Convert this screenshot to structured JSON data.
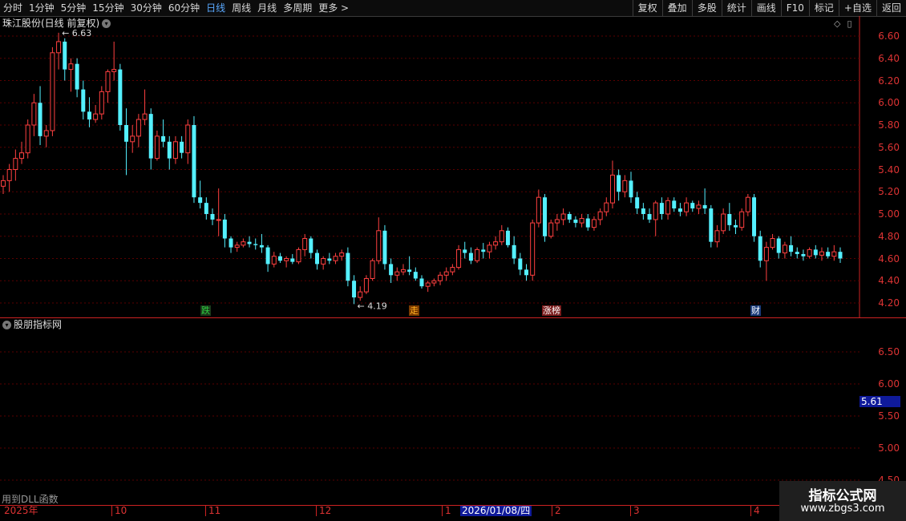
{
  "toolbar": {
    "periods": [
      "分时",
      "1分钟",
      "5分钟",
      "15分钟",
      "30分钟",
      "60分钟",
      "日线",
      "周线",
      "月线",
      "多周期",
      "更多 >"
    ],
    "active_period": "日线",
    "buttons": [
      "复权",
      "叠加",
      "多股",
      "统计",
      "画线",
      "F10",
      "标记",
      "+自选",
      "返回"
    ]
  },
  "title": {
    "label": "珠江股份(日线 前复权)"
  },
  "main_axis": [
    "6.60",
    "6.40",
    "6.20",
    "6.00",
    "5.80",
    "5.60",
    "5.40",
    "5.20",
    "5.00",
    "4.80",
    "4.60",
    "4.40",
    "4.20"
  ],
  "max_label": "6.63",
  "min_label": "4.19",
  "tags": [
    {
      "text": "跌",
      "color": "#2ecc40",
      "bg": "#1a3a1a"
    },
    {
      "text": "走",
      "color": "#ffb020",
      "bg": "#7a3a00"
    },
    {
      "text": "涨榜",
      "color": "#ffffff",
      "bg": "#7a1a1a"
    },
    {
      "text": "财",
      "color": "#ffffff",
      "bg": "#1a3a7a"
    }
  ],
  "indicator": {
    "title": "股朋指标网",
    "axis": [
      "6.50",
      "6.00",
      "5.50",
      "5.00",
      "4.50"
    ],
    "current_value": "5.61",
    "dll_text": "用到DLL函数"
  },
  "dates": {
    "labels": [
      "2025年",
      "10",
      "11",
      "12",
      "1",
      "2",
      "3",
      "4"
    ],
    "current": "2026/01/08/四"
  },
  "watermark": {
    "line1": "指标公式网",
    "line2": "www.zbgs3.com"
  },
  "colors": {
    "up": "#ff4040",
    "down": "#54f0ff",
    "grid": "#5a0000",
    "axis": "#cc2222"
  },
  "chart_data": {
    "type": "candlestick",
    "title": "珠江股份(日线 前复权)",
    "ylim": [
      4.12,
      6.68
    ],
    "max": 6.63,
    "min": 4.19,
    "candles": [
      [
        5.25,
        5.35,
        5.18,
        5.3
      ],
      [
        5.3,
        5.45,
        5.2,
        5.4
      ],
      [
        5.4,
        5.58,
        5.3,
        5.5
      ],
      [
        5.5,
        5.65,
        5.45,
        5.55
      ],
      [
        5.55,
        5.85,
        5.5,
        5.8
      ],
      [
        5.8,
        6.08,
        5.7,
        6.0
      ],
      [
        6.0,
        6.15,
        5.62,
        5.7
      ],
      [
        5.7,
        5.8,
        5.6,
        5.75
      ],
      [
        5.75,
        6.5,
        5.7,
        6.45
      ],
      [
        6.45,
        6.63,
        6.3,
        6.55
      ],
      [
        6.55,
        6.58,
        6.2,
        6.3
      ],
      [
        6.3,
        6.4,
        6.1,
        6.35
      ],
      [
        6.35,
        6.4,
        6.05,
        6.12
      ],
      [
        6.12,
        6.2,
        5.85,
        5.92
      ],
      [
        5.92,
        6.05,
        5.78,
        5.85
      ],
      [
        5.85,
        5.98,
        5.82,
        5.9
      ],
      [
        5.9,
        6.15,
        5.85,
        6.1
      ],
      [
        6.1,
        6.3,
        6.0,
        6.28
      ],
      [
        6.28,
        6.55,
        6.2,
        6.3
      ],
      [
        6.3,
        6.35,
        5.75,
        5.8
      ],
      [
        5.8,
        5.95,
        5.35,
        5.65
      ],
      [
        5.65,
        5.8,
        5.55,
        5.7
      ],
      [
        5.7,
        5.9,
        5.6,
        5.85
      ],
      [
        5.85,
        6.12,
        5.8,
        5.9
      ],
      [
        5.9,
        5.95,
        5.4,
        5.5
      ],
      [
        5.5,
        5.75,
        5.48,
        5.7
      ],
      [
        5.7,
        5.85,
        5.6,
        5.65
      ],
      [
        5.65,
        5.7,
        5.4,
        5.5
      ],
      [
        5.5,
        5.7,
        5.45,
        5.65
      ],
      [
        5.65,
        5.7,
        5.5,
        5.55
      ],
      [
        5.55,
        5.85,
        5.45,
        5.8
      ],
      [
        5.8,
        5.88,
        5.1,
        5.15
      ],
      [
        5.15,
        5.3,
        5.05,
        5.1
      ],
      [
        5.1,
        5.15,
        4.95,
        5.0
      ],
      [
        5.0,
        5.05,
        4.9,
        4.95
      ],
      [
        4.95,
        5.23,
        4.8,
        4.95
      ],
      [
        4.95,
        5.0,
        4.7,
        4.78
      ],
      [
        4.78,
        4.8,
        4.65,
        4.7
      ],
      [
        4.7,
        4.75,
        4.66,
        4.72
      ],
      [
        4.72,
        4.78,
        4.7,
        4.75
      ],
      [
        4.75,
        4.8,
        4.7,
        4.73
      ],
      [
        4.73,
        4.78,
        4.68,
        4.72
      ],
      [
        4.72,
        4.82,
        4.65,
        4.7
      ],
      [
        4.7,
        4.72,
        4.48,
        4.55
      ],
      [
        4.55,
        4.66,
        4.52,
        4.62
      ],
      [
        4.62,
        4.65,
        4.56,
        4.58
      ],
      [
        4.58,
        4.62,
        4.52,
        4.6
      ],
      [
        4.6,
        4.64,
        4.55,
        4.57
      ],
      [
        4.57,
        4.7,
        4.55,
        4.68
      ],
      [
        4.68,
        4.82,
        4.62,
        4.78
      ],
      [
        4.78,
        4.8,
        4.6,
        4.65
      ],
      [
        4.65,
        4.68,
        4.5,
        4.55
      ],
      [
        4.55,
        4.62,
        4.5,
        4.6
      ],
      [
        4.6,
        4.65,
        4.55,
        4.58
      ],
      [
        4.58,
        4.65,
        4.55,
        4.62
      ],
      [
        4.62,
        4.68,
        4.58,
        4.65
      ],
      [
        4.65,
        4.7,
        4.35,
        4.4
      ],
      [
        4.4,
        4.45,
        4.19,
        4.25
      ],
      [
        4.25,
        4.35,
        4.22,
        4.3
      ],
      [
        4.3,
        4.45,
        4.28,
        4.42
      ],
      [
        4.42,
        4.6,
        4.4,
        4.58
      ],
      [
        4.58,
        4.97,
        4.55,
        4.85
      ],
      [
        4.85,
        4.9,
        4.5,
        4.55
      ],
      [
        4.55,
        4.6,
        4.38,
        4.45
      ],
      [
        4.45,
        4.52,
        4.4,
        4.48
      ],
      [
        4.48,
        4.55,
        4.45,
        4.5
      ],
      [
        4.5,
        4.62,
        4.45,
        4.48
      ],
      [
        4.48,
        4.52,
        4.4,
        4.42
      ],
      [
        4.42,
        4.45,
        4.33,
        4.35
      ],
      [
        4.35,
        4.4,
        4.3,
        4.38
      ],
      [
        4.38,
        4.42,
        4.35,
        4.4
      ],
      [
        4.4,
        4.48,
        4.36,
        4.45
      ],
      [
        4.45,
        4.52,
        4.4,
        4.48
      ],
      [
        4.48,
        4.55,
        4.45,
        4.52
      ],
      [
        4.52,
        4.72,
        4.5,
        4.68
      ],
      [
        4.68,
        4.75,
        4.6,
        4.65
      ],
      [
        4.65,
        4.7,
        4.55,
        4.58
      ],
      [
        4.58,
        4.7,
        4.56,
        4.68
      ],
      [
        4.68,
        4.74,
        4.6,
        4.66
      ],
      [
        4.66,
        4.75,
        4.6,
        4.72
      ],
      [
        4.72,
        4.8,
        4.68,
        4.75
      ],
      [
        4.75,
        4.9,
        4.72,
        4.85
      ],
      [
        4.85,
        4.88,
        4.7,
        4.72
      ],
      [
        4.72,
        4.8,
        4.55,
        4.6
      ],
      [
        4.6,
        4.65,
        4.45,
        4.5
      ],
      [
        4.5,
        4.55,
        4.4,
        4.45
      ],
      [
        4.45,
        4.95,
        4.4,
        4.92
      ],
      [
        4.92,
        5.22,
        4.88,
        5.15
      ],
      [
        5.15,
        5.18,
        4.75,
        4.8
      ],
      [
        4.8,
        4.95,
        4.78,
        4.92
      ],
      [
        4.92,
        5.0,
        4.85,
        4.95
      ],
      [
        4.95,
        5.05,
        4.9,
        5.0
      ],
      [
        5.0,
        5.02,
        4.92,
        4.95
      ],
      [
        4.95,
        4.98,
        4.88,
        4.92
      ],
      [
        4.92,
        5.0,
        4.88,
        4.96
      ],
      [
        4.96,
        5.0,
        4.85,
        4.88
      ],
      [
        4.88,
        4.98,
        4.85,
        4.95
      ],
      [
        4.95,
        5.05,
        4.9,
        5.02
      ],
      [
        5.02,
        5.15,
        4.98,
        5.1
      ],
      [
        5.1,
        5.48,
        5.05,
        5.35
      ],
      [
        5.35,
        5.4,
        5.12,
        5.2
      ],
      [
        5.2,
        5.35,
        5.15,
        5.3
      ],
      [
        5.3,
        5.38,
        5.1,
        5.15
      ],
      [
        5.15,
        5.2,
        5.0,
        5.05
      ],
      [
        5.05,
        5.1,
        4.95,
        5.0
      ],
      [
        5.0,
        5.05,
        4.92,
        4.95
      ],
      [
        4.95,
        5.12,
        4.8,
        5.1
      ],
      [
        5.1,
        5.15,
        4.95,
        5.0
      ],
      [
        5.0,
        5.15,
        4.95,
        5.12
      ],
      [
        5.12,
        5.15,
        5.02,
        5.05
      ],
      [
        5.05,
        5.1,
        4.98,
        5.02
      ],
      [
        5.02,
        5.15,
        4.98,
        5.1
      ],
      [
        5.1,
        5.12,
        5.02,
        5.05
      ],
      [
        5.05,
        5.12,
        5.0,
        5.08
      ],
      [
        5.08,
        5.23,
        5.0,
        5.05
      ],
      [
        5.05,
        5.08,
        4.7,
        4.75
      ],
      [
        4.75,
        4.9,
        4.7,
        4.85
      ],
      [
        4.85,
        5.05,
        4.82,
        5.0
      ],
      [
        5.0,
        5.1,
        4.85,
        4.9
      ],
      [
        4.9,
        4.95,
        4.82,
        4.88
      ],
      [
        4.88,
        5.05,
        4.85,
        5.02
      ],
      [
        5.02,
        5.18,
        4.98,
        5.15
      ],
      [
        5.15,
        5.18,
        4.75,
        4.8
      ],
      [
        4.8,
        4.85,
        4.52,
        4.58
      ],
      [
        4.58,
        4.75,
        4.4,
        4.7
      ],
      [
        4.7,
        4.82,
        4.68,
        4.78
      ],
      [
        4.78,
        4.8,
        4.6,
        4.65
      ],
      [
        4.65,
        4.75,
        4.6,
        4.72
      ],
      [
        4.72,
        4.8,
        4.62,
        4.66
      ],
      [
        4.66,
        4.7,
        4.6,
        4.64
      ],
      [
        4.64,
        4.68,
        4.58,
        4.62
      ],
      [
        4.62,
        4.7,
        4.6,
        4.68
      ],
      [
        4.68,
        4.72,
        4.6,
        4.63
      ],
      [
        4.63,
        4.7,
        4.58,
        4.66
      ],
      [
        4.66,
        4.7,
        4.6,
        4.62
      ],
      [
        4.62,
        4.72,
        4.58,
        4.66
      ],
      [
        4.66,
        4.7,
        4.56,
        4.6
      ]
    ]
  }
}
